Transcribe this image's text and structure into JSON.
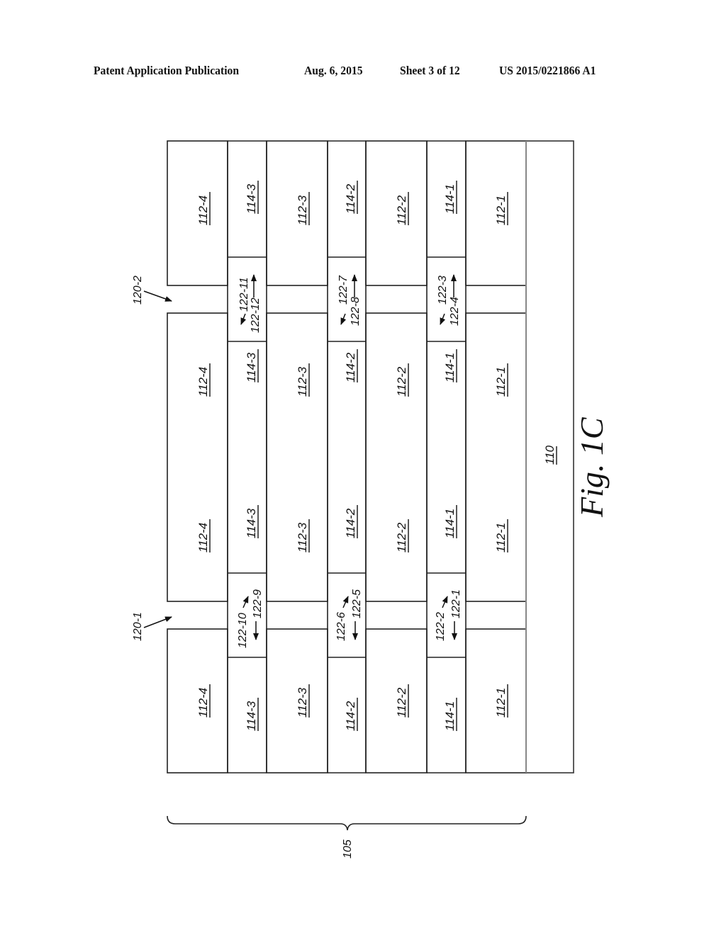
{
  "header": {
    "publication": "Patent Application Publication",
    "date": "Aug. 6, 2015",
    "sheet": "Sheet 3 of 12",
    "number": "US 2015/0221866 A1"
  },
  "figure": {
    "title": "Fig. 1C",
    "substrate_label": "110",
    "stack_label": "105",
    "trench_labels": [
      "120-1",
      "120-2"
    ],
    "columns": [
      {
        "id": "c112-4",
        "labels": [
          "112-4",
          "112-4",
          "112-4",
          "112-4"
        ]
      },
      {
        "id": "c114-3",
        "labels": [
          "114-3",
          "114-3",
          "114-3",
          "114-3"
        ]
      },
      {
        "id": "c112-3",
        "labels": [
          "112-3",
          "112-3",
          "112-3",
          "112-3"
        ]
      },
      {
        "id": "c114-2",
        "labels": [
          "114-2",
          "114-2",
          "114-2",
          "114-2"
        ]
      },
      {
        "id": "c112-2",
        "labels": [
          "112-2",
          "112-2",
          "112-2",
          "112-2"
        ]
      },
      {
        "id": "c114-1",
        "labels": [
          "114-1",
          "114-1",
          "114-1",
          "114-1"
        ]
      },
      {
        "id": "c112-1",
        "labels": [
          "112-1",
          "112-1",
          "112-1",
          "112-1"
        ]
      }
    ],
    "spacer_labels_top": [
      {
        "a": "122-11",
        "b": "122-12"
      },
      {
        "a": "122-7",
        "b": "122-8"
      },
      {
        "a": "122-3",
        "b": "122-4"
      }
    ],
    "spacer_labels_bottom": [
      {
        "a": "122-10",
        "b": "122-9"
      },
      {
        "a": "122-6",
        "b": "122-5"
      },
      {
        "a": "122-2",
        "b": "122-1"
      }
    ]
  }
}
